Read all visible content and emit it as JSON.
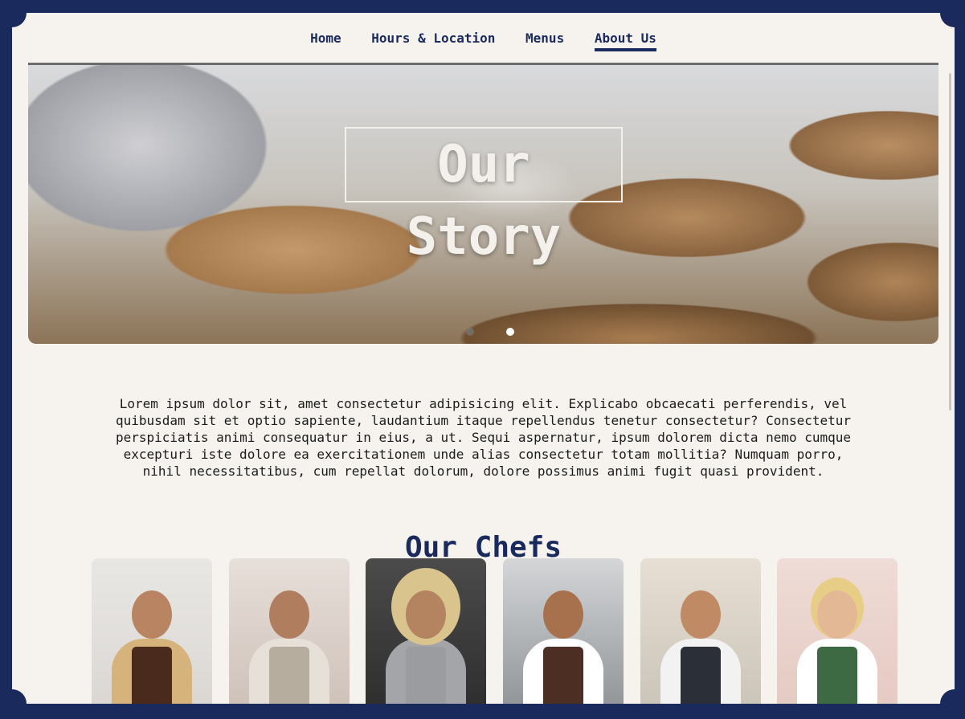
{
  "nav": {
    "items": [
      {
        "label": "Home",
        "active": false
      },
      {
        "label": "Hours & Location",
        "active": false
      },
      {
        "label": "Menus",
        "active": false
      },
      {
        "label": "About Us",
        "active": true
      }
    ]
  },
  "hero": {
    "title": "Our Story",
    "carousel": {
      "slide_count": 2,
      "active_index": 1
    }
  },
  "story": {
    "text": "Lorem ipsum dolor sit, amet consectetur adipisicing elit. Explicabo obcaecati perferendis, vel quibusdam sit et optio sapiente, laudantium itaque repellendus tenetur consectetur? Consectetur perspiciatis animi consequatur in eius, a ut. Sequi aspernatur, ipsum dolorem dicta nemo cumque excepturi iste dolore ea exercitationem unde alias consectetur totam mollitia? Numquam porro, nihil necessitatibus, cum repellat dolorum, dolore possimus animi fugit quasi provident."
  },
  "chefs": {
    "title": "Our Chefs",
    "count": 6
  },
  "colors": {
    "brand_navy": "#1a2a5c",
    "background": "#f6f3ee"
  }
}
